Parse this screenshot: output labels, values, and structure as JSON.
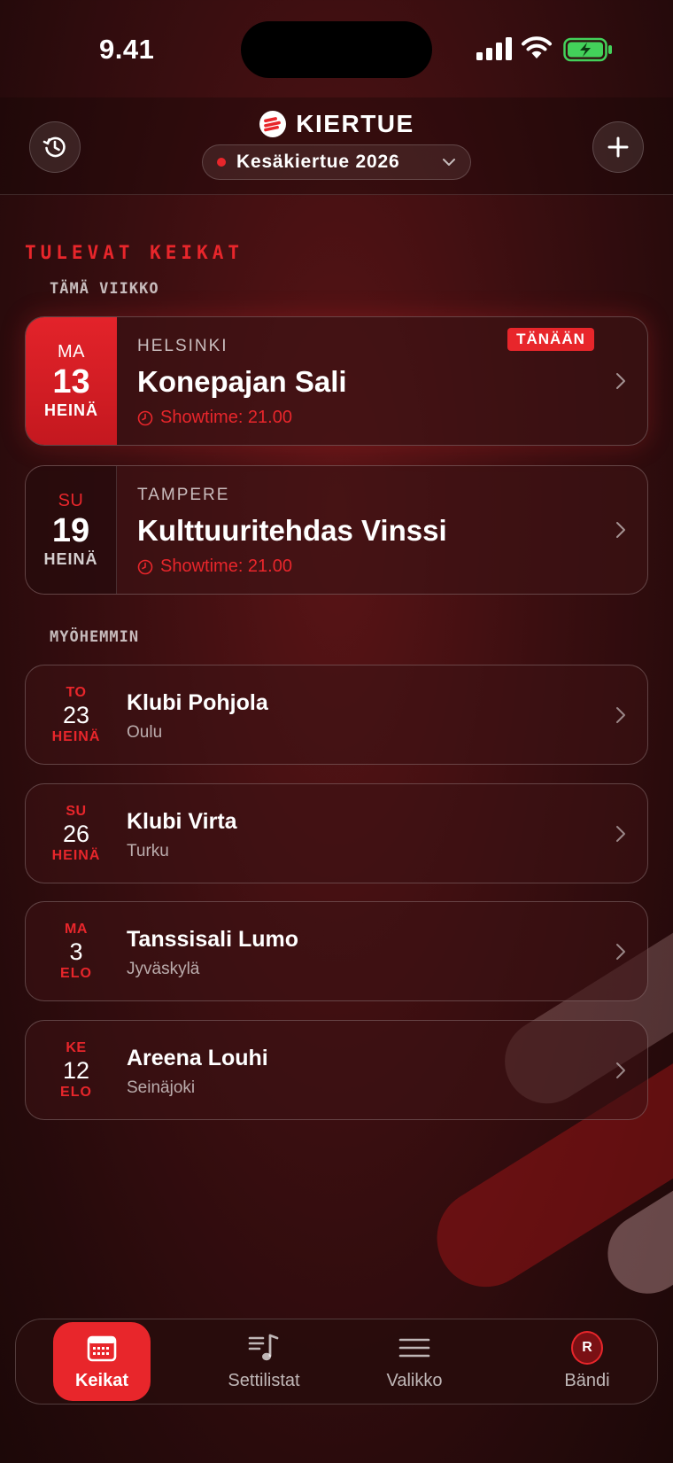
{
  "status": {
    "time": "9.41"
  },
  "header": {
    "brand": "KIERTUE",
    "tour": "Kesäkiertue 2026"
  },
  "section_title": "TULEVAT KEIKAT",
  "this_week_label": "TÄMÄ VIIKKO",
  "later_label": "MYÖHEMMIN",
  "featured": [
    {
      "weekday": "MA",
      "day": "13",
      "month": "HEINÄ",
      "city": "HELSINKI",
      "venue": "Konepajan Sali",
      "showtime": "Showtime: 21.00",
      "badge": "TÄNÄÄN"
    },
    {
      "weekday": "SU",
      "day": "19",
      "month": "HEINÄ",
      "city": "TAMPERE",
      "venue": "Kulttuuritehdas Vinssi",
      "showtime": "Showtime: 21.00"
    }
  ],
  "later": [
    {
      "weekday": "TO",
      "day": "23",
      "month": "HEINÄ",
      "venue": "Klubi Pohjola",
      "city": "Oulu"
    },
    {
      "weekday": "SU",
      "day": "26",
      "month": "HEINÄ",
      "venue": "Klubi Virta",
      "city": "Turku"
    },
    {
      "weekday": "MA",
      "day": "3",
      "month": "ELO",
      "venue": "Tanssisali Lumo",
      "city": "Jyväskylä"
    },
    {
      "weekday": "KE",
      "day": "12",
      "month": "ELO",
      "venue": "Areena Louhi",
      "city": "Seinäjoki"
    }
  ],
  "tabs": [
    {
      "label": "Keikat",
      "icon": "calendar-icon",
      "active": true
    },
    {
      "label": "Settilistat",
      "icon": "music-list-icon",
      "active": false
    },
    {
      "label": "Valikko",
      "icon": "menu-icon",
      "active": false
    },
    {
      "label": "Bändi",
      "icon": "avatar",
      "active": false,
      "avatar_letter": "R"
    }
  ],
  "colors": {
    "accent": "#e8262b",
    "background": "#3a0e10"
  }
}
